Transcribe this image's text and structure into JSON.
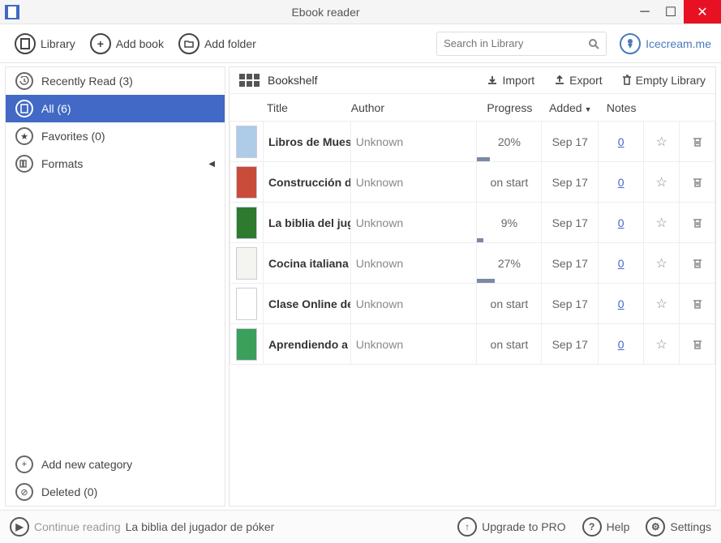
{
  "window": {
    "title": "Ebook reader"
  },
  "toolbar": {
    "library": "Library",
    "add_book": "Add book",
    "add_folder": "Add folder",
    "search_placeholder": "Search in Library",
    "brand": "Icecream.me"
  },
  "sidebar": {
    "recently_read": "Recently Read (3)",
    "all": "All (6)",
    "favorites": "Favorites (0)",
    "formats": "Formats",
    "add_category": "Add new category",
    "deleted": "Deleted (0)"
  },
  "content": {
    "heading": "Bookshelf",
    "import": "Import",
    "export": "Export",
    "empty": "Empty Library",
    "columns": {
      "title": "Title",
      "author": "Author",
      "progress": "Progress",
      "added": "Added",
      "notes": "Notes"
    }
  },
  "books": [
    {
      "title": "Libros de Mues",
      "author": "Unknown",
      "progress_text": "20%",
      "progress_pct": 20,
      "added": "Sep 17",
      "notes": "0",
      "thumb": "#aecbe8"
    },
    {
      "title": "Construcción de",
      "author": "Unknown",
      "progress_text": "on start",
      "progress_pct": 0,
      "added": "Sep 17",
      "notes": "0",
      "thumb": "#c94b3a"
    },
    {
      "title": "La biblia del jug",
      "author": "Unknown",
      "progress_text": "9%",
      "progress_pct": 9,
      "added": "Sep 17",
      "notes": "0",
      "thumb": "#2e7a2e"
    },
    {
      "title": "Cocina italiana",
      "author": "Unknown",
      "progress_text": "27%",
      "progress_pct": 27,
      "added": "Sep 17",
      "notes": "0",
      "thumb": "#f4f4f0"
    },
    {
      "title": "Clase Online de",
      "author": "Unknown",
      "progress_text": "on start",
      "progress_pct": 0,
      "added": "Sep 17",
      "notes": "0",
      "thumb": "#ffffff"
    },
    {
      "title": "Aprendiendo a",
      "author": "Unknown",
      "progress_text": "on start",
      "progress_pct": 0,
      "added": "Sep 17",
      "notes": "0",
      "thumb": "#3aa05a"
    }
  ],
  "footer": {
    "continue_label": "Continue reading",
    "continue_title": "La biblia del jugador de póker",
    "upgrade": "Upgrade to PRO",
    "help": "Help",
    "settings": "Settings"
  }
}
